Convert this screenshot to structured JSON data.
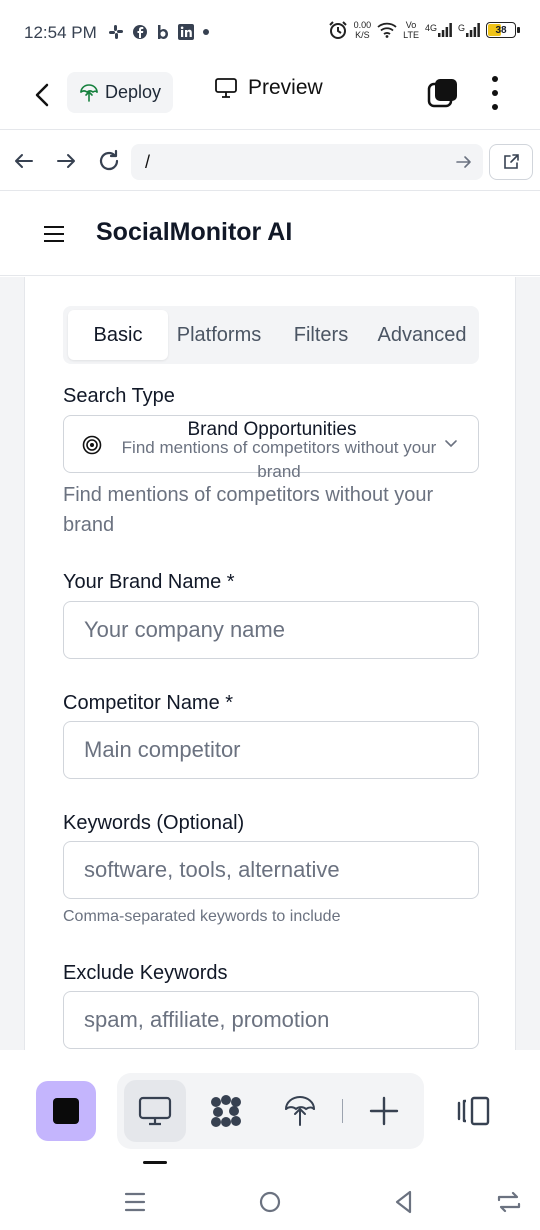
{
  "status_bar": {
    "time": "12:54 PM",
    "notification_icons": [
      "slack-icon",
      "facebook-icon",
      "b-icon",
      "linkedin-icon",
      "dot-icon"
    ],
    "net_speed": "0.00",
    "net_unit": "K/S",
    "volte_top": "Vo",
    "volte_bottom": "LTE",
    "net_4g": "4G",
    "net_g": "G",
    "battery_level": "38"
  },
  "toolbar": {
    "deploy_label": "Deploy",
    "preview_label": "Preview"
  },
  "url_bar": {
    "url_value": "/"
  },
  "site": {
    "title": "SocialMonitor AI"
  },
  "tabs": [
    {
      "label": "Basic",
      "active": true
    },
    {
      "label": "Platforms",
      "active": false
    },
    {
      "label": "Filters",
      "active": false
    },
    {
      "label": "Advanced",
      "active": false
    }
  ],
  "form": {
    "search_type_label": "Search Type",
    "search_type_selected_title": "Brand Opportunities",
    "search_type_selected_desc": "Find mentions of competitors without your brand",
    "search_type_help": "Find mentions of competitors without your brand",
    "brand_label": "Your Brand Name *",
    "brand_placeholder": "Your company name",
    "competitor_label": "Competitor Name *",
    "competitor_placeholder": "Main competitor",
    "keywords_label": "Keywords (Optional)",
    "keywords_placeholder": "software, tools, alternative",
    "keywords_help": "Comma-separated keywords to include",
    "exclude_label": "Exclude Keywords",
    "exclude_placeholder": "spam, affiliate, promotion"
  },
  "colors": {
    "accent_purple": "#c4b5fd",
    "deploy_icon_green": "#15803d",
    "muted_text": "#6b7280",
    "border": "#d1d5db"
  }
}
